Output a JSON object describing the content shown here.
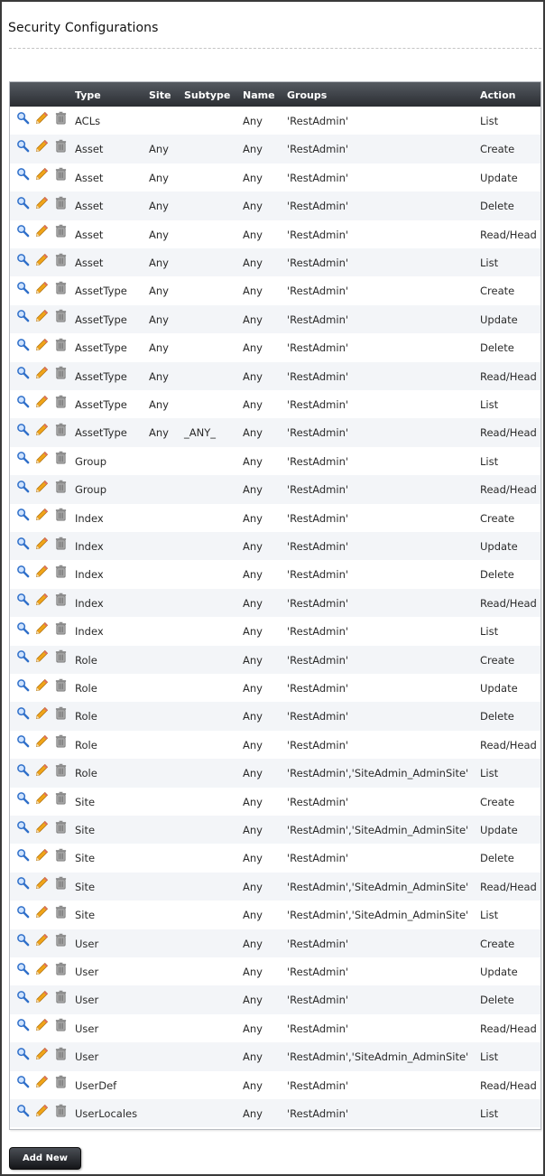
{
  "page": {
    "title": "Security Configurations"
  },
  "table": {
    "columns": {
      "type": "Type",
      "site": "Site",
      "subtype": "Subtype",
      "name": "Name",
      "groups": "Groups",
      "action": "Action"
    },
    "rows": [
      {
        "type": "ACLs",
        "site": "",
        "subtype": "",
        "name": "Any",
        "groups": "'RestAdmin'",
        "action": "List"
      },
      {
        "type": "Asset",
        "site": "Any",
        "subtype": "",
        "name": "Any",
        "groups": "'RestAdmin'",
        "action": "Create"
      },
      {
        "type": "Asset",
        "site": "Any",
        "subtype": "",
        "name": "Any",
        "groups": "'RestAdmin'",
        "action": "Update"
      },
      {
        "type": "Asset",
        "site": "Any",
        "subtype": "",
        "name": "Any",
        "groups": "'RestAdmin'",
        "action": "Delete"
      },
      {
        "type": "Asset",
        "site": "Any",
        "subtype": "",
        "name": "Any",
        "groups": "'RestAdmin'",
        "action": "Read/Head"
      },
      {
        "type": "Asset",
        "site": "Any",
        "subtype": "",
        "name": "Any",
        "groups": "'RestAdmin'",
        "action": "List"
      },
      {
        "type": "AssetType",
        "site": "Any",
        "subtype": "",
        "name": "Any",
        "groups": "'RestAdmin'",
        "action": "Create"
      },
      {
        "type": "AssetType",
        "site": "Any",
        "subtype": "",
        "name": "Any",
        "groups": "'RestAdmin'",
        "action": "Update"
      },
      {
        "type": "AssetType",
        "site": "Any",
        "subtype": "",
        "name": "Any",
        "groups": "'RestAdmin'",
        "action": "Delete"
      },
      {
        "type": "AssetType",
        "site": "Any",
        "subtype": "",
        "name": "Any",
        "groups": "'RestAdmin'",
        "action": "Read/Head"
      },
      {
        "type": "AssetType",
        "site": "Any",
        "subtype": "",
        "name": "Any",
        "groups": "'RestAdmin'",
        "action": "List"
      },
      {
        "type": "AssetType",
        "site": "Any",
        "subtype": "_ANY_",
        "name": "Any",
        "groups": "'RestAdmin'",
        "action": "Read/Head"
      },
      {
        "type": "Group",
        "site": "",
        "subtype": "",
        "name": "Any",
        "groups": "'RestAdmin'",
        "action": "List"
      },
      {
        "type": "Group",
        "site": "",
        "subtype": "",
        "name": "Any",
        "groups": "'RestAdmin'",
        "action": "Read/Head"
      },
      {
        "type": "Index",
        "site": "",
        "subtype": "",
        "name": "Any",
        "groups": "'RestAdmin'",
        "action": "Create"
      },
      {
        "type": "Index",
        "site": "",
        "subtype": "",
        "name": "Any",
        "groups": "'RestAdmin'",
        "action": "Update"
      },
      {
        "type": "Index",
        "site": "",
        "subtype": "",
        "name": "Any",
        "groups": "'RestAdmin'",
        "action": "Delete"
      },
      {
        "type": "Index",
        "site": "",
        "subtype": "",
        "name": "Any",
        "groups": "'RestAdmin'",
        "action": "Read/Head"
      },
      {
        "type": "Index",
        "site": "",
        "subtype": "",
        "name": "Any",
        "groups": "'RestAdmin'",
        "action": "List"
      },
      {
        "type": "Role",
        "site": "",
        "subtype": "",
        "name": "Any",
        "groups": "'RestAdmin'",
        "action": "Create"
      },
      {
        "type": "Role",
        "site": "",
        "subtype": "",
        "name": "Any",
        "groups": "'RestAdmin'",
        "action": "Update"
      },
      {
        "type": "Role",
        "site": "",
        "subtype": "",
        "name": "Any",
        "groups": "'RestAdmin'",
        "action": "Delete"
      },
      {
        "type": "Role",
        "site": "",
        "subtype": "",
        "name": "Any",
        "groups": "'RestAdmin'",
        "action": "Read/Head"
      },
      {
        "type": "Role",
        "site": "",
        "subtype": "",
        "name": "Any",
        "groups": "'RestAdmin','SiteAdmin_AdminSite'",
        "action": "List"
      },
      {
        "type": "Site",
        "site": "",
        "subtype": "",
        "name": "Any",
        "groups": "'RestAdmin'",
        "action": "Create"
      },
      {
        "type": "Site",
        "site": "",
        "subtype": "",
        "name": "Any",
        "groups": "'RestAdmin','SiteAdmin_AdminSite'",
        "action": "Update"
      },
      {
        "type": "Site",
        "site": "",
        "subtype": "",
        "name": "Any",
        "groups": "'RestAdmin'",
        "action": "Delete"
      },
      {
        "type": "Site",
        "site": "",
        "subtype": "",
        "name": "Any",
        "groups": "'RestAdmin','SiteAdmin_AdminSite'",
        "action": "Read/Head"
      },
      {
        "type": "Site",
        "site": "",
        "subtype": "",
        "name": "Any",
        "groups": "'RestAdmin','SiteAdmin_AdminSite'",
        "action": "List"
      },
      {
        "type": "User",
        "site": "",
        "subtype": "",
        "name": "Any",
        "groups": "'RestAdmin'",
        "action": "Create"
      },
      {
        "type": "User",
        "site": "",
        "subtype": "",
        "name": "Any",
        "groups": "'RestAdmin'",
        "action": "Update"
      },
      {
        "type": "User",
        "site": "",
        "subtype": "",
        "name": "Any",
        "groups": "'RestAdmin'",
        "action": "Delete"
      },
      {
        "type": "User",
        "site": "",
        "subtype": "",
        "name": "Any",
        "groups": "'RestAdmin'",
        "action": "Read/Head"
      },
      {
        "type": "User",
        "site": "",
        "subtype": "",
        "name": "Any",
        "groups": "'RestAdmin','SiteAdmin_AdminSite'",
        "action": "List"
      },
      {
        "type": "UserDef",
        "site": "",
        "subtype": "",
        "name": "Any",
        "groups": "'RestAdmin'",
        "action": "Read/Head"
      },
      {
        "type": "UserLocales",
        "site": "",
        "subtype": "",
        "name": "Any",
        "groups": "'RestAdmin'",
        "action": "List"
      }
    ],
    "row_icons": [
      "inspect-icon",
      "edit-icon",
      "delete-icon"
    ]
  },
  "footer": {
    "add_label": "Add New"
  },
  "colors": {
    "header_top": "#555a61",
    "header_bottom": "#2a2d32",
    "row_alt": "#f3f5f8",
    "pencil": "#f0a419",
    "magnifier": "#3a7bd5",
    "trash": "#8a8a8a"
  }
}
